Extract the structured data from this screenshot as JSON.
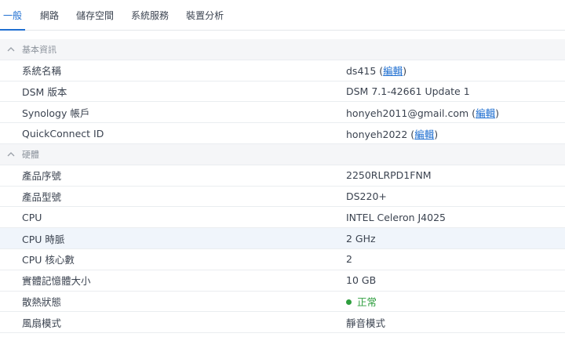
{
  "tabs": [
    "一般",
    "網路",
    "儲存空間",
    "系統服務",
    "裝置分析"
  ],
  "basic": {
    "title": "基本資訊",
    "system_name_label": "系統名稱",
    "system_name": "ds415",
    "dsm_label": "DSM 版本",
    "dsm_value": "DSM 7.1-42661 Update 1",
    "account_label": "Synology 帳戶",
    "account_value": "honyeh2011@gmail.com",
    "qc_label": "QuickConnect ID",
    "qc_value": "honyeh2022",
    "edit": "編輯"
  },
  "hardware": {
    "title": "硬體",
    "serial_label": "產品序號",
    "serial_value": "2250RLRPD1FNM",
    "model_label": "產品型號",
    "model_value": "DS220+",
    "cpu_label": "CPU",
    "cpu_value": "INTEL Celeron J4025",
    "clock_label": "CPU 時脈",
    "clock_value": "2 GHz",
    "cores_label": "CPU 核心數",
    "cores_value": "2",
    "mem_label": "實體記憶體大小",
    "mem_value": "10 GB",
    "thermal_label": "散熱狀態",
    "thermal_value": "正常",
    "fan_label": "風扇模式",
    "fan_value": "靜音模式"
  },
  "colors": {
    "accent": "#1f6fd1",
    "ok": "#2e9e3e"
  }
}
